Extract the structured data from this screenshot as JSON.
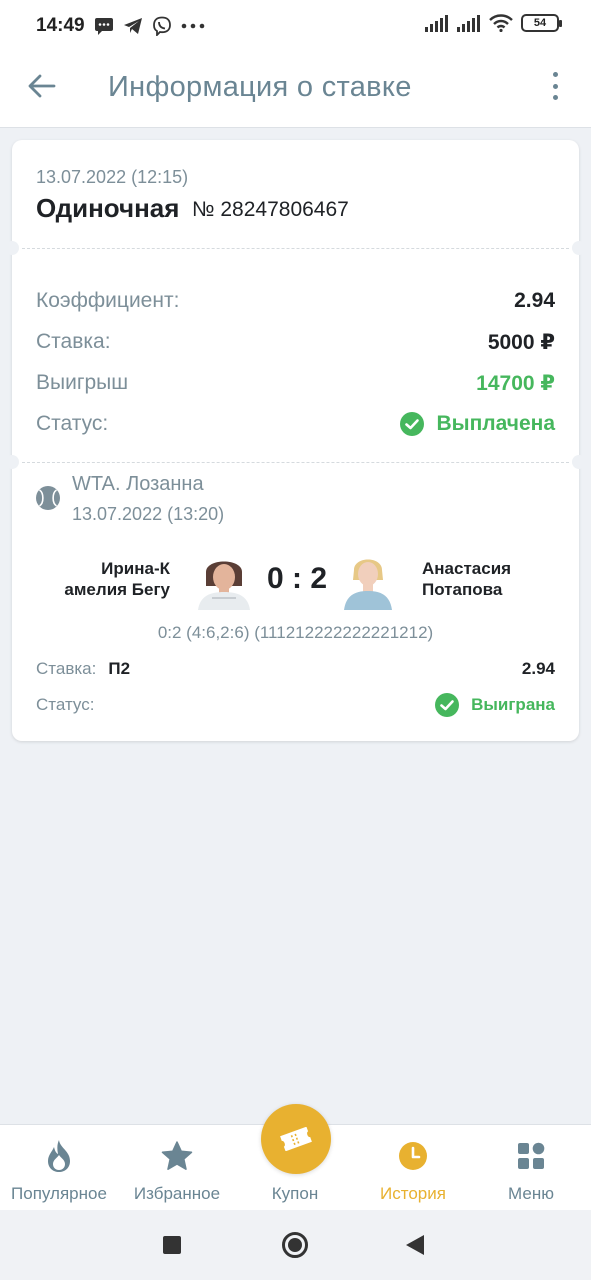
{
  "status_bar": {
    "time": "14:49",
    "battery": "54"
  },
  "app_bar": {
    "title": "Информация о ставке",
    "back_icon": "arrow-left-icon",
    "more_icon": "more-vertical-icon"
  },
  "bet": {
    "date": "13.07.2022 (12:15)",
    "type": "Одиночная",
    "number": "№ 28247806467",
    "rows": {
      "coefficient_label": "Коэффициент:",
      "coefficient_value": "2.94",
      "stake_label": "Ставка:",
      "stake_value": "5000 ₽",
      "winnings_label": "Выигрыш",
      "winnings_value": "14700 ₽",
      "status_label": "Статус:",
      "status_value": "Выплачена"
    }
  },
  "event": {
    "league": "WTA. Лозанна",
    "date": "13.07.2022 (13:20)",
    "player1_line1": "Ирина-К",
    "player1_line2": "амелия Бегу",
    "score": "0 : 2",
    "player2_line1": "Анастасия",
    "player2_line2": "Потапова",
    "set_details": "0:2 (4:6,2:6) (111212222222221212)",
    "stake_label": "Ставка:",
    "pick": "П2",
    "coefficient": "2.94",
    "status_label": "Статус:",
    "status_value": "Выиграна"
  },
  "bottom_nav": {
    "items": [
      {
        "label": "Популярное",
        "icon": "flame-icon"
      },
      {
        "label": "Избранное",
        "icon": "star-icon"
      },
      {
        "label": "Купон",
        "icon": "ticket-icon"
      },
      {
        "label": "История",
        "icon": "clock-icon"
      },
      {
        "label": "Меню",
        "icon": "grid-icon"
      }
    ],
    "active_color": "#e8b130",
    "inactive_color": "#6a8593"
  },
  "colors": {
    "accent": "#e8b130",
    "success": "#46b75d",
    "muted_text": "#7d8f99"
  }
}
